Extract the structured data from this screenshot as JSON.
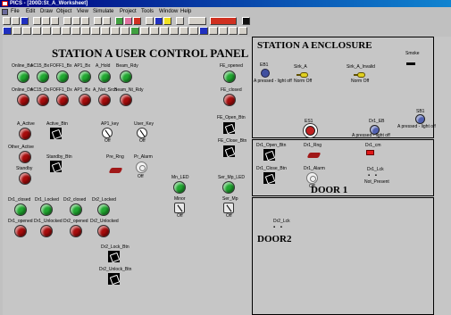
{
  "window": {
    "title": "PICS - [200D:St_A_Worksheet]"
  },
  "menu": [
    "File",
    "Edit",
    "Draw",
    "Object",
    "View",
    "Simulate",
    "Project",
    "Tools",
    "Window",
    "Help"
  ],
  "panel_a": {
    "title": "STATION A USER CONTROL PANEL",
    "row1": [
      "Online_Bx",
      "AC15_Bx",
      "FOFF1_Bx",
      "AP1_Bx",
      "A_Hold",
      "Beam_Rdy"
    ],
    "fe_opened": "FE_opened",
    "row2": [
      "Online_Dx",
      "AC15_Dx",
      "FOFF1_Dx",
      "AP1_Bx",
      "A_Not_Srch",
      "Beam_Nt_Rdy"
    ],
    "fe_closed": "FE_closed",
    "fe_open_btn": "FE_Open_Btn",
    "fe_close_btn": "FE_Close_Btn",
    "a_active": "A_Active",
    "active_btn": "Active_Btn",
    "ap1_key": "AP1_key",
    "user_key": "User_Key",
    "off": "Off",
    "other_active": "Other_Active",
    "standby": "Standby",
    "standby_btn": "Standby_Btn",
    "pre_rng": "Pre_Rng",
    "pr_alarm": "Pr_Alarm",
    "mn_led": "Mn_LED",
    "ser_mp_led": "Ser_Mp_LED",
    "minor": "Minor",
    "ser_mp": "Ser_Mp",
    "row5": [
      "Dr1_closed",
      "Dr1_Locked",
      "Dr2_closed",
      "Dr2_Locked"
    ],
    "row6": [
      "Dr1_opened",
      "Dr1_Unlocked",
      "Dr2_opened",
      "Dr2_Unlocked"
    ],
    "dr2_lock_btn": "Dr2_Lock_Btn",
    "dr2_unlock_btn": "Dr2_Unlock_Btn"
  },
  "panel_enclosure": {
    "title": "STATION A ENCLOSURE",
    "smoke": "Smoke",
    "eb1": "EB1",
    "eb1_note": "A pressed - light off",
    "sirk_a": "Sirk_A",
    "sirk_a_state": "Norm Off",
    "sirk_a_invalid": "Sirk_A_Invalid",
    "sirk_a_invalid_state": "Norm Off",
    "es1": "ES1",
    "dr1_eb": "Dr1_EB",
    "dr1_eb_note": "A pressed - light off",
    "sb1": "SB1",
    "sb1_note": "A pressed - light off"
  },
  "panel_door1": {
    "title": "DOOR 1",
    "dr1_open_btn": "Dr1_Open_Btn",
    "dr1_rng": "Dr1_Rng",
    "dr1_cm": "Dr1_cm",
    "dr1_close_btn": "Dr1_Close_Btn",
    "dr1_alarm": "Dr1_Alarm",
    "dr1_lck": "Dr1_Lck",
    "off": "Off",
    "not_present": "Not_Present"
  },
  "panel_door2": {
    "title": "DOOR2",
    "dr2_lck": "Dr2_Lck"
  },
  "colors": {
    "led_green": "#20a830",
    "led_red": "#a80c0c",
    "title_bar": "#000080"
  }
}
